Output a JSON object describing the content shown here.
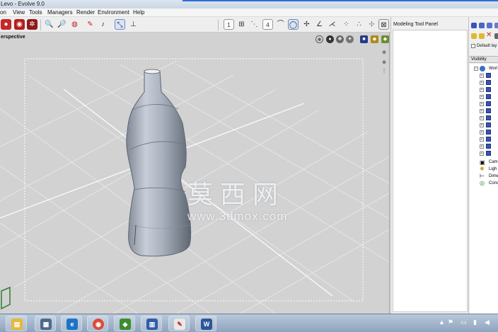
{
  "window": {
    "title": "Levo - Evolve 9.0"
  },
  "menu": [
    "on",
    "View",
    "Tools",
    "Managers",
    "Render",
    "Environment",
    "Help"
  ],
  "toolbar": {
    "view_numbers": [
      "1",
      "4"
    ]
  },
  "viewport": {
    "label": "erspective"
  },
  "watermark": {
    "chinese": "莫西网",
    "url": "www.3dmox.com"
  },
  "panel": {
    "title": "Modeling Tool Panel"
  },
  "right_panel": {
    "layer_label": "Default lay",
    "visibility_label": "Visibility",
    "tree": [
      {
        "label": "Worl",
        "kind": "world"
      },
      {
        "label": "",
        "kind": "object"
      },
      {
        "label": "",
        "kind": "object"
      },
      {
        "label": "",
        "kind": "object"
      },
      {
        "label": "",
        "kind": "object"
      },
      {
        "label": "",
        "kind": "object"
      },
      {
        "label": "",
        "kind": "object"
      },
      {
        "label": "",
        "kind": "object"
      },
      {
        "label": "",
        "kind": "object"
      },
      {
        "label": "",
        "kind": "object"
      },
      {
        "label": "",
        "kind": "object"
      },
      {
        "label": "",
        "kind": "object"
      },
      {
        "label": "",
        "kind": "object"
      },
      {
        "label": "Cam",
        "kind": "camera"
      },
      {
        "label": "Ligh",
        "kind": "light"
      },
      {
        "label": "Dime",
        "kind": "dimension"
      },
      {
        "label": "Cons",
        "kind": "construction"
      }
    ]
  },
  "taskbar": {
    "apps": [
      "file-explorer-icon",
      "system-monitor-icon",
      "internet-explorer-icon",
      "chrome-icon",
      "evolve-app-icon",
      "windows-installer-icon",
      "paint-icon",
      "word-icon"
    ]
  },
  "colors": {
    "title_accent": "#2a6fd6",
    "viewport_bg": "#d2d2d2",
    "object_cube": "#3854b8"
  }
}
